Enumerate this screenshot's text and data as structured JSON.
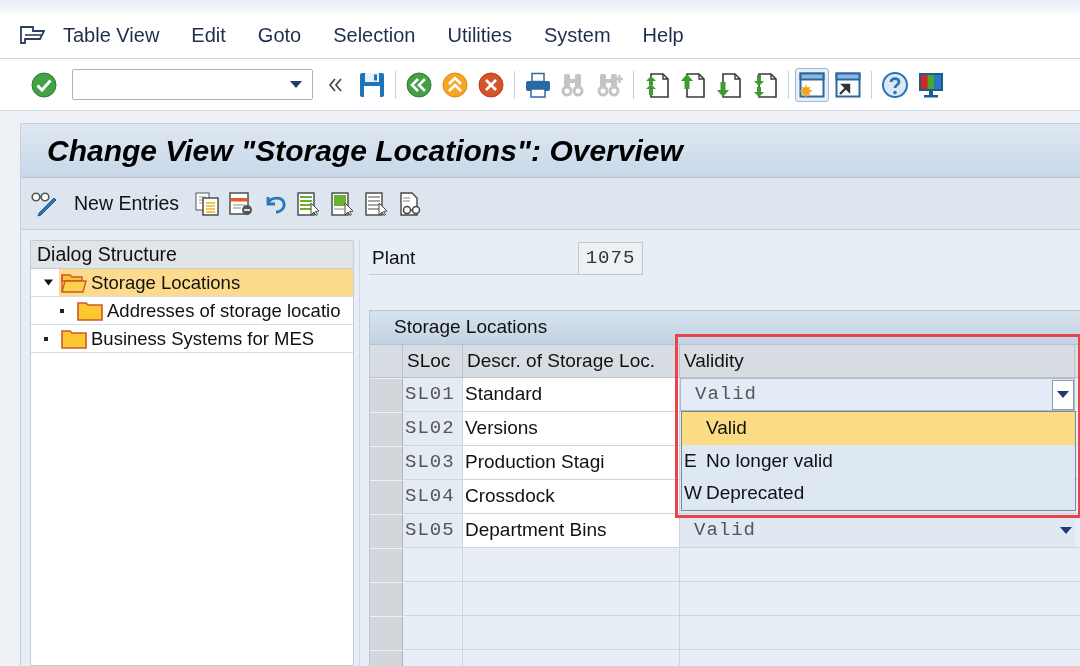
{
  "menu_bar": {
    "items": [
      "Table View",
      "Edit",
      "Goto",
      "Selection",
      "Utilities",
      "System",
      "Help"
    ]
  },
  "standard_toolbar": {
    "buttons": [
      {
        "disabled": false,
        "highlighted": false
      },
      {
        "disabled": false,
        "highlighted": false
      },
      {
        "disabled": false,
        "highlighted": false
      },
      {
        "disabled": false,
        "highlighted": false
      },
      {
        "disabled": false,
        "highlighted": false
      },
      {
        "disabled": false,
        "highlighted": false
      },
      {
        "disabled": false,
        "highlighted": false
      },
      {
        "disabled": true,
        "highlighted": false
      },
      {
        "disabled": true,
        "highlighted": false
      },
      {
        "disabled": false,
        "highlighted": false
      },
      {
        "disabled": false,
        "highlighted": false
      },
      {
        "disabled": false,
        "highlighted": false
      },
      {
        "disabled": false,
        "highlighted": false
      },
      {
        "disabled": false,
        "highlighted": true
      },
      {
        "disabled": false,
        "highlighted": false
      },
      {
        "disabled": false,
        "highlighted": false
      },
      {
        "disabled": false,
        "highlighted": false
      }
    ]
  },
  "title": "Change View \"Storage Locations\": Overview",
  "application_toolbar": {
    "new_entries": "New Entries"
  },
  "dialog_structure": {
    "title": "Dialog Structure",
    "items": [
      {
        "label": "Storage Locations",
        "selected": true,
        "expanded": true,
        "children": [
          {
            "label": "Addresses of storage locatio",
            "selected": false,
            "expanded": false
          }
        ]
      },
      {
        "label": "Business Systems for MES",
        "selected": false,
        "expanded": false
      }
    ]
  },
  "plant": {
    "label": "Plant",
    "value": "1075"
  },
  "table": {
    "title": "Storage Locations",
    "columns": [
      {
        "label": "SLoc",
        "highlighted": false
      },
      {
        "label": "Descr. of Storage Loc.",
        "highlighted": false
      },
      {
        "label": "Validity",
        "highlighted": true
      }
    ],
    "rows": [
      {
        "sloc": "SL01",
        "description": "Standard",
        "validity": "Valid",
        "focused": true
      },
      {
        "sloc": "SL02",
        "description": "Versions"
      },
      {
        "sloc": "SL03",
        "description": "Production Stagi"
      },
      {
        "sloc": "SL04",
        "description": "Crossdock"
      },
      {
        "sloc": "SL05",
        "description": "Department Bins",
        "validity": "Valid",
        "focused": false
      }
    ]
  },
  "validity_dropdown": {
    "open": true,
    "options": [
      {
        "text": "Valid",
        "selected": true
      },
      {
        "key": "E",
        "text": "No longer valid",
        "selected": false
      },
      {
        "key": "W",
        "text": "Deprecated",
        "selected": false
      }
    ]
  }
}
